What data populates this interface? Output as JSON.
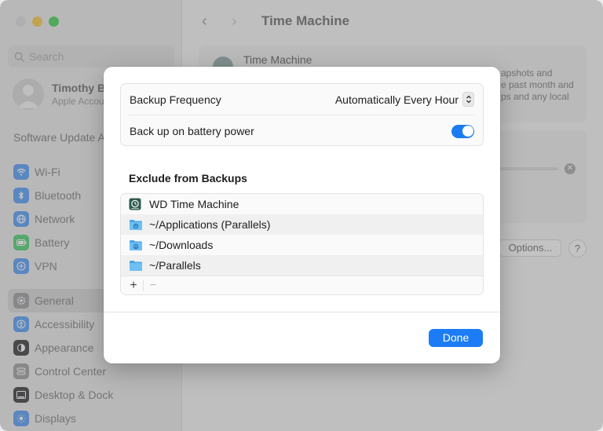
{
  "sidebar": {
    "search_placeholder": "Search",
    "account_name": "Timothy B",
    "account_sub": "Apple Accou",
    "software_update": "Software Update A",
    "items": [
      {
        "label": "Wi-Fi",
        "icon": "wifi-icon",
        "color": "#3b8cf5"
      },
      {
        "label": "Bluetooth",
        "icon": "bluetooth-icon",
        "color": "#3b8cf5"
      },
      {
        "label": "Network",
        "icon": "globe-icon",
        "color": "#3b8cf5"
      },
      {
        "label": "Battery",
        "icon": "battery-icon",
        "color": "#33c759"
      },
      {
        "label": "VPN",
        "icon": "vpn-icon",
        "color": "#3b8cf5"
      },
      {
        "label": "General",
        "icon": "gear-icon",
        "color": "#8e8e93"
      },
      {
        "label": "Accessibility",
        "icon": "accessibility-icon",
        "color": "#3b8cf5"
      },
      {
        "label": "Appearance",
        "icon": "appearance-icon",
        "color": "#1d1d1f"
      },
      {
        "label": "Control Center",
        "icon": "control-center-icon",
        "color": "#8e8e93"
      },
      {
        "label": "Desktop & Dock",
        "icon": "dock-icon",
        "color": "#1d1d1f"
      },
      {
        "label": "Displays",
        "icon": "displays-icon",
        "color": "#3b8cf5"
      }
    ]
  },
  "main": {
    "title": "Time Machine",
    "card_title": "Time Machine",
    "bg_desc_line1": "apshots and",
    "bg_desc_line2": "e past month and",
    "bg_desc_line3": "ps and any local",
    "options_label": "Options...",
    "help_label": "?"
  },
  "sheet": {
    "backup_frequency_label": "Backup Frequency",
    "backup_frequency_value": "Automatically Every Hour",
    "battery_label": "Back up on battery power",
    "battery_on": true,
    "exclude_title": "Exclude from Backups",
    "exclusions": [
      {
        "label": "WD Time Machine",
        "icon": "time-machine-drive-icon"
      },
      {
        "label": "~/Applications (Parallels)",
        "icon": "applications-folder-icon"
      },
      {
        "label": "~/Downloads",
        "icon": "downloads-folder-icon"
      },
      {
        "label": "~/Parallels",
        "icon": "folder-icon"
      }
    ],
    "add_label": "+",
    "remove_label": "−",
    "done_label": "Done"
  },
  "colors": {
    "accent": "#1c7cf5",
    "toggle_on": "#1a7cf0"
  }
}
